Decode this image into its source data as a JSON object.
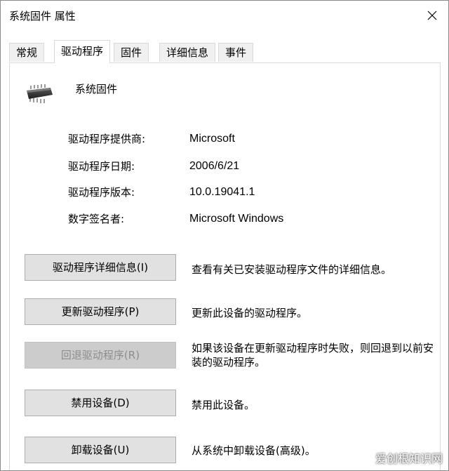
{
  "window": {
    "title": "系统固件 属性"
  },
  "tabs": [
    {
      "label": "常规",
      "active": false
    },
    {
      "label": "驱动程序",
      "active": true
    },
    {
      "label": "固件",
      "active": false
    },
    {
      "label": "详细信息",
      "active": false
    },
    {
      "label": "事件",
      "active": false
    }
  ],
  "device": {
    "name": "系统固件",
    "icon": "chip-icon"
  },
  "driver_info": [
    {
      "label": "驱动程序提供商:",
      "value": "Microsoft"
    },
    {
      "label": "驱动程序日期:",
      "value": "2006/6/21"
    },
    {
      "label": "驱动程序版本:",
      "value": "10.0.19041.1"
    },
    {
      "label": "数字签名者:",
      "value": "Microsoft Windows"
    }
  ],
  "actions": [
    {
      "label": "驱动程序详细信息(I)",
      "description": "查看有关已安装驱动程序文件的详细信息。",
      "enabled": true
    },
    {
      "label": "更新驱动程序(P)",
      "description": "更新此设备的驱动程序。",
      "enabled": true
    },
    {
      "label": "回退驱动程序(R)",
      "description": "如果该设备在更新驱动程序时失败，则回退到以前安装的驱动程序。",
      "enabled": false
    },
    {
      "label": "禁用设备(D)",
      "description": "禁用此设备。",
      "enabled": true
    },
    {
      "label": "卸载设备(U)",
      "description": "从系统中卸载设备(高级)。",
      "enabled": true
    }
  ],
  "watermark": "爱创根知识网",
  "colors": {
    "button_bg": "#e1e1e1",
    "button_disabled_bg": "#cccccc",
    "disabled_text": "#8d8d8d",
    "border": "#d9d9d9"
  }
}
